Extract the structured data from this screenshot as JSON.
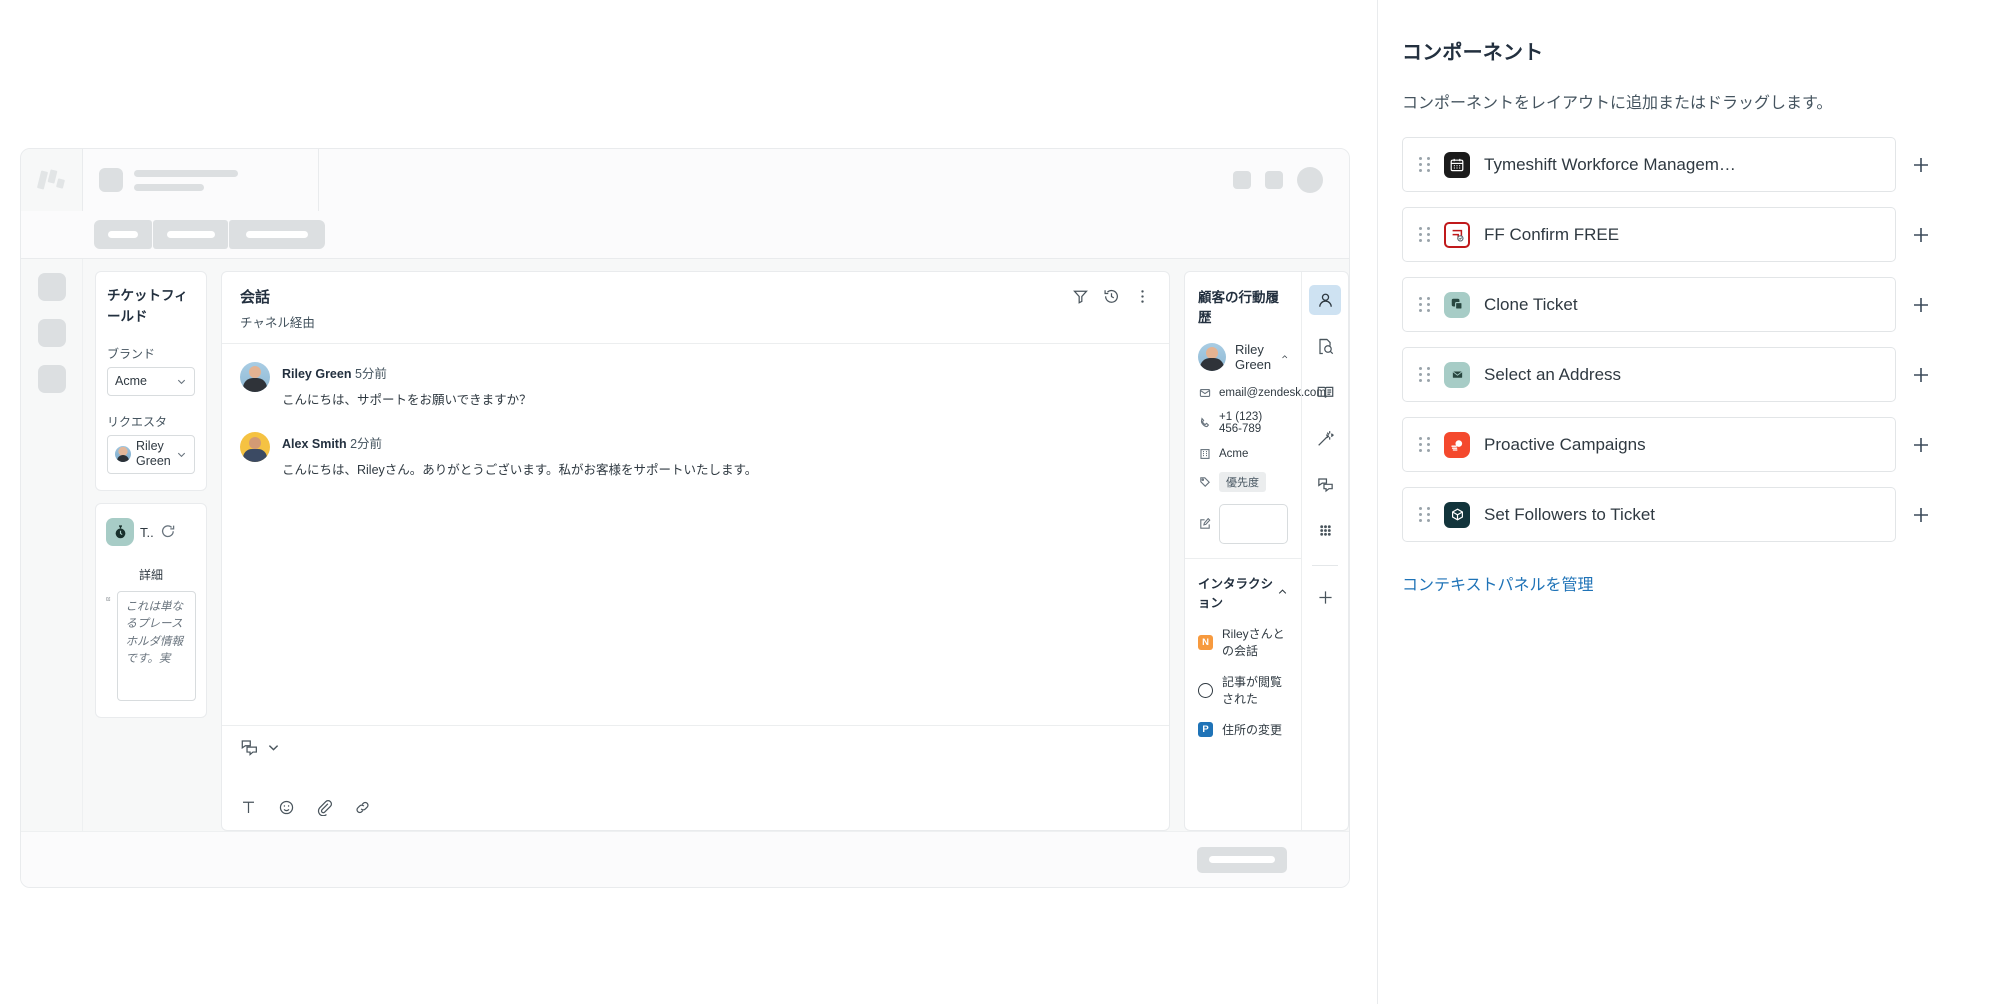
{
  "panel": {
    "title": "コンポーネント",
    "description": "コンポーネントをレイアウトに追加またはドラッグします。",
    "manage_link": "コンテキストパネルを管理",
    "add_label": "+",
    "components": [
      {
        "label": "Tymeshift Workforce Managem…",
        "icon": "calendar-icon",
        "icon_bg": "#1b1b1b",
        "icon_fg": "#ffffff"
      },
      {
        "label": "FF Confirm FREE",
        "icon": "ff-confirm-icon",
        "icon_bg": "#ffffff",
        "icon_fg": "#c0191b"
      },
      {
        "label": "Clone Ticket",
        "icon": "clone-icon",
        "icon_bg": "#a7ccc6",
        "icon_fg": "#2f4f4a"
      },
      {
        "label": "Select an Address",
        "icon": "envelope-icon",
        "icon_bg": "#a7ccc6",
        "icon_fg": "#2f4f4a"
      },
      {
        "label": "Proactive Campaigns",
        "icon": "megaphone-icon",
        "icon_bg": "#f4492d",
        "icon_fg": "#ffffff"
      },
      {
        "label": "Set Followers to Ticket",
        "icon": "cube-icon",
        "icon_bg": "#12343b",
        "icon_fg": "#ffffff"
      }
    ]
  },
  "preview": {
    "fields": {
      "title": "チケットフィールド",
      "brand_label": "ブランド",
      "brand_value": "Acme",
      "requester_label": "リクエスタ",
      "requester_value": "Riley Green"
    },
    "app": {
      "name": "T..",
      "details_label": "詳細",
      "placeholder_text": "これは単なるプレースホルダ情報です。実"
    },
    "conversation": {
      "title": "会話",
      "subtitle": "チャネル経由",
      "messages": [
        {
          "author": "Riley Green",
          "time": "5分前",
          "text": "こんにちは、サポートをお願いできますか？"
        },
        {
          "author": "Alex Smith",
          "time": "2分前",
          "text": "こんにちは、Rileyさん。ありがとうございます。私がお客様をサポートいたします。"
        }
      ]
    },
    "context": {
      "title": "顧客の行動履歴",
      "user_name": "Riley Green",
      "email": "email@zendesk.com",
      "phone": "+1 (123) 456-789",
      "org": "Acme",
      "tag": "優先度",
      "note_value": "",
      "interactions_title": "インタラクション",
      "events": [
        {
          "label": "Rileyさんとの会話",
          "badge": "N",
          "badge_color": "#f79a3e"
        },
        {
          "label": "記事が閲覧された",
          "badge": "",
          "badge_color": ""
        },
        {
          "label": "住所の変更",
          "badge": "P",
          "badge_color": "#1f73b7"
        }
      ]
    }
  }
}
